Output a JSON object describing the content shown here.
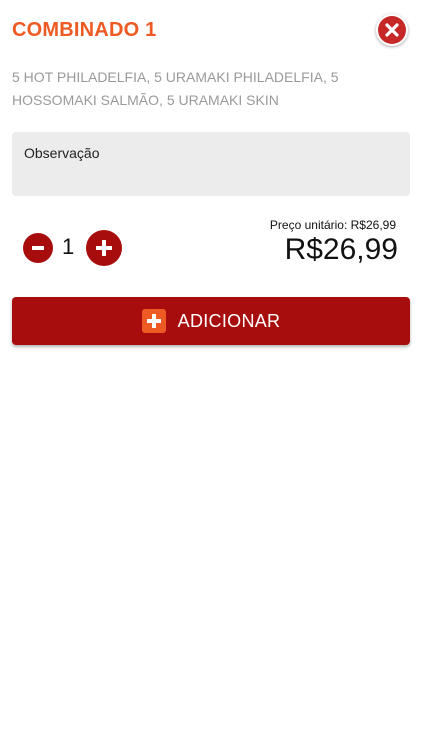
{
  "product": {
    "title": "COMBINADO 1",
    "description": "5 HOT PHILADELFIA, 5 URAMAKI PHILADELFIA, 5 HOSSOMAKI SALMÃO, 5 URAMAKI SKIN"
  },
  "observation": {
    "label": "Observação"
  },
  "quantity": {
    "value": "1"
  },
  "price": {
    "unit_label": "Preço unitário: R$26,99",
    "total": "R$26,99"
  },
  "add_button": {
    "label": "ADICIONAR"
  },
  "icons": {
    "close": "close-icon",
    "minus": "minus-icon",
    "plus": "plus-icon",
    "add": "plus-square-icon"
  },
  "colors": {
    "title": "#ee5a24",
    "primary": "#a80d0d",
    "close_bg": "#c62828",
    "add_icon_bg": "#ee5a24",
    "description": "#9a9a9a",
    "field_bg": "#ececec"
  }
}
